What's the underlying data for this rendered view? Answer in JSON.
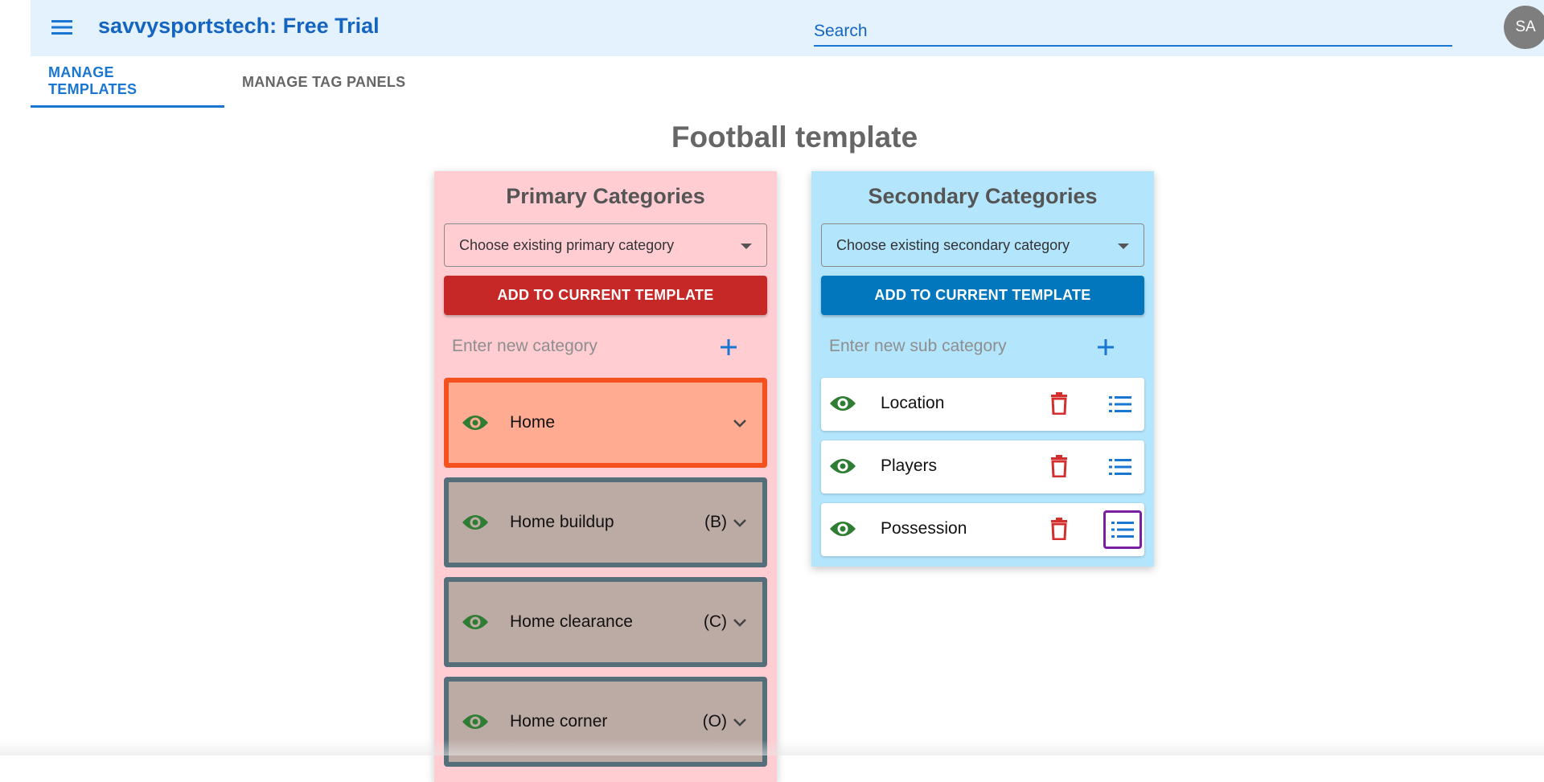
{
  "header": {
    "title": "savvysportstech: Free Trial",
    "search_placeholder": "Search",
    "avatar_initials": "SA",
    "menu_icon": "hamburger-menu-icon",
    "background_color": "#e3f2fd",
    "title_color": "#1565c0"
  },
  "tabs": [
    {
      "label": "MANAGE TEMPLATES",
      "active": true
    },
    {
      "label": "MANAGE TAG PANELS",
      "active": false
    }
  ],
  "page": {
    "title": "Football template"
  },
  "primary": {
    "title": "Primary Categories",
    "select_placeholder": "Choose existing primary category",
    "add_button": "ADD TO CURRENT TEMPLATE",
    "new_placeholder": "Enter new category",
    "background_color": "#ffcdd2",
    "button_color": "#c62828",
    "items": [
      {
        "label": "Home",
        "code": "",
        "active": true
      },
      {
        "label": "Home buildup",
        "code": "(B)",
        "active": false
      },
      {
        "label": "Home clearance",
        "code": "(C)",
        "active": false
      },
      {
        "label": "Home corner",
        "code": "(O)",
        "active": false
      }
    ]
  },
  "secondary": {
    "title": "Secondary Categories",
    "select_placeholder": "Choose existing secondary category",
    "add_button": "ADD TO CURRENT TEMPLATE",
    "new_placeholder": "Enter new sub category",
    "background_color": "#b3e5fc",
    "button_color": "#0277bd",
    "items": [
      {
        "label": "Location"
      },
      {
        "label": "Players"
      },
      {
        "label": "Possession"
      }
    ]
  },
  "icons": {
    "visibility": "eye-icon",
    "delete": "trash-icon",
    "list": "list-icon",
    "expand": "chevron-down-icon",
    "add": "plus-icon"
  },
  "colors": {
    "active_item_bg": "#ffab91",
    "active_item_border": "#f4511e",
    "item_bg": "#bcaaa4",
    "item_border": "#546e7a",
    "eye": "#2e7d32",
    "delete": "#d32f2f",
    "list": "#1976d2",
    "focus": "#7b1fa2"
  }
}
